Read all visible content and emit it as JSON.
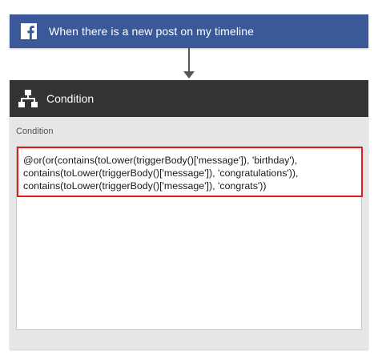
{
  "trigger": {
    "icon": "facebook-icon",
    "title": "When there is a new post on my timeline",
    "color": "#3b5998"
  },
  "condition": {
    "icon": "condition-flowchart-icon",
    "header_title": "Condition",
    "header_color": "#333333",
    "field_label": "Condition",
    "expression_lines": [
      "@or(or(contains(toLower(triggerBody()['message']), 'birthday'),",
      "contains(toLower(triggerBody()['message']), 'congratulations')),",
      "contains(toLower(triggerBody()['message']), 'congrats'))"
    ],
    "highlight_color": "#e21b1b"
  }
}
